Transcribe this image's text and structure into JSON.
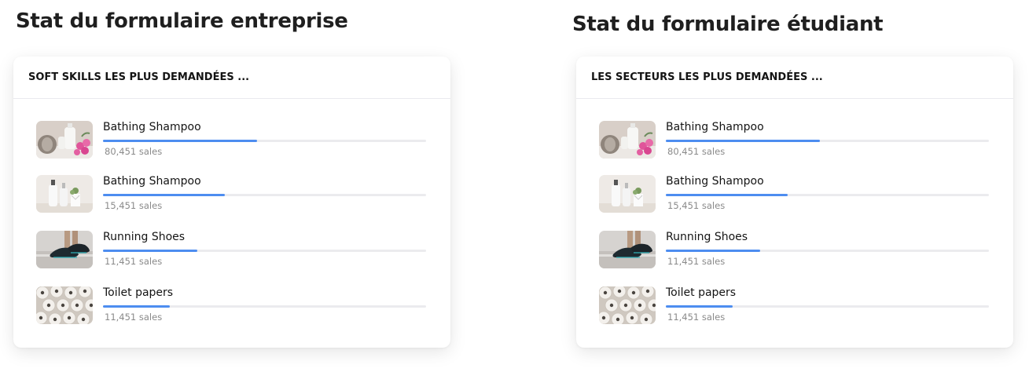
{
  "panels": [
    {
      "heading": "Stat du formulaire entreprise",
      "card_title": "SOFT SKILLS LES PLUS DEMANDÉES ...",
      "items": [
        {
          "name": "Bathing Shampoo",
          "sales": "80,451 sales",
          "progress": 0.478,
          "image_icon": "towel-shampoo-flowers-image"
        },
        {
          "name": "Bathing Shampoo",
          "sales": "15,451 sales",
          "progress": 0.378,
          "image_icon": "shampoo-bottles-image"
        },
        {
          "name": "Running Shoes",
          "sales": "11,451 sales",
          "progress": 0.292,
          "image_icon": "running-shoes-image"
        },
        {
          "name": "Toilet papers",
          "sales": "11,451 sales",
          "progress": 0.207,
          "image_icon": "toilet-paper-rolls-image"
        }
      ]
    },
    {
      "heading": "Stat du formulaire étudiant",
      "card_title": "LES SECTEURS LES PLUS DEMANDÉES ...",
      "items": [
        {
          "name": "Bathing Shampoo",
          "sales": "80,451 sales",
          "progress": 0.478,
          "image_icon": "towel-shampoo-flowers-image"
        },
        {
          "name": "Bathing Shampoo",
          "sales": "15,451 sales",
          "progress": 0.378,
          "image_icon": "shampoo-bottles-image"
        },
        {
          "name": "Running Shoes",
          "sales": "11,451 sales",
          "progress": 0.292,
          "image_icon": "running-shoes-image"
        },
        {
          "name": "Toilet papers",
          "sales": "11,451 sales",
          "progress": 0.207,
          "image_icon": "toilet-paper-rolls-image"
        }
      ]
    }
  ],
  "colors": {
    "progress_fill": "#4d8df0",
    "progress_track": "#ebebee"
  }
}
